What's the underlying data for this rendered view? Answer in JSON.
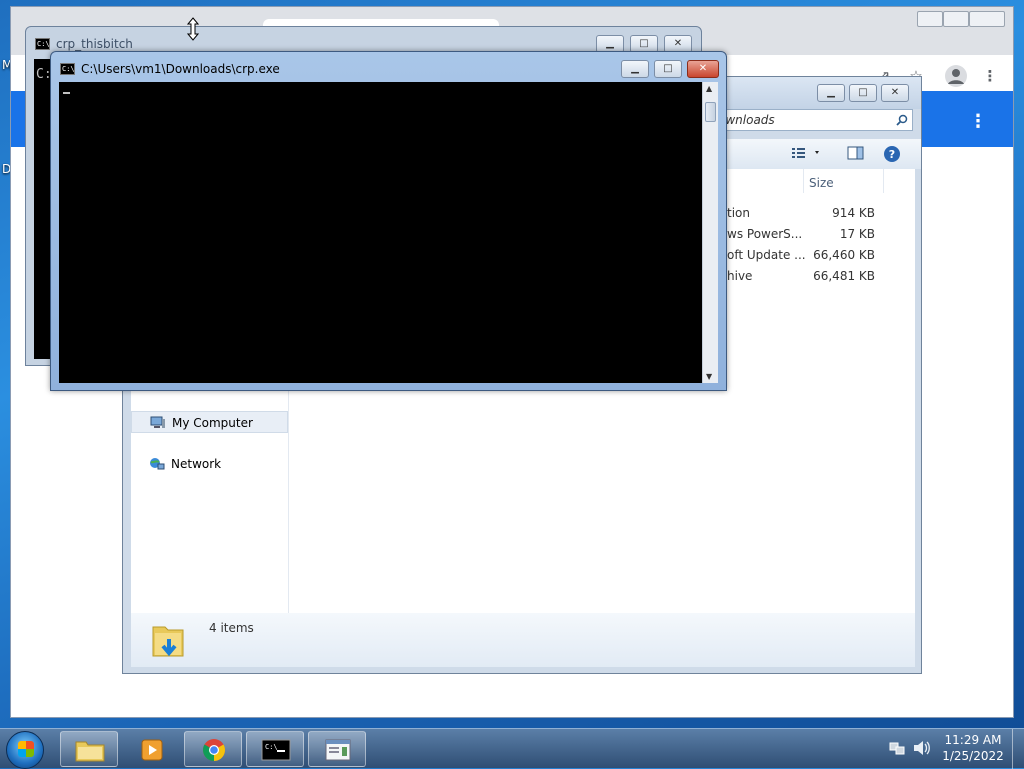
{
  "desktop": {
    "frag_m": "M",
    "frag_d": "D"
  },
  "explorer": {
    "address_text": "ownloads",
    "columns": {
      "size": "Size"
    },
    "files": [
      {
        "type_fragment": "tion",
        "size": "914 KB"
      },
      {
        "type_fragment": "ws PowerS...",
        "size": "17 KB"
      },
      {
        "type_fragment": "oft Update ...",
        "size": "66,460 KB"
      },
      {
        "type_fragment": "hive",
        "size": "66,481 KB"
      }
    ],
    "nav": {
      "my_computer": "My Computer",
      "network": "Network"
    },
    "status": {
      "item_count": "4 items"
    }
  },
  "console_back": {
    "title": "crp_thisbitch",
    "prompt_fragment": "C:"
  },
  "console_front": {
    "title": "C:\\Users\\vm1\\Downloads\\crp.exe"
  },
  "window_controls": {
    "minimize": "▁",
    "maximize": "□",
    "close": "✕"
  },
  "tray": {
    "time": "11:29 AM",
    "date": "1/25/2022"
  },
  "colors": {
    "chrome_blue": "#1a73e8",
    "console_bg": "#000000"
  },
  "icons": {
    "share": "share-icon",
    "star": "star-icon",
    "profile": "profile-icon",
    "menu": "kebab-menu-icon",
    "search": "search-icon",
    "help": "help-icon"
  }
}
